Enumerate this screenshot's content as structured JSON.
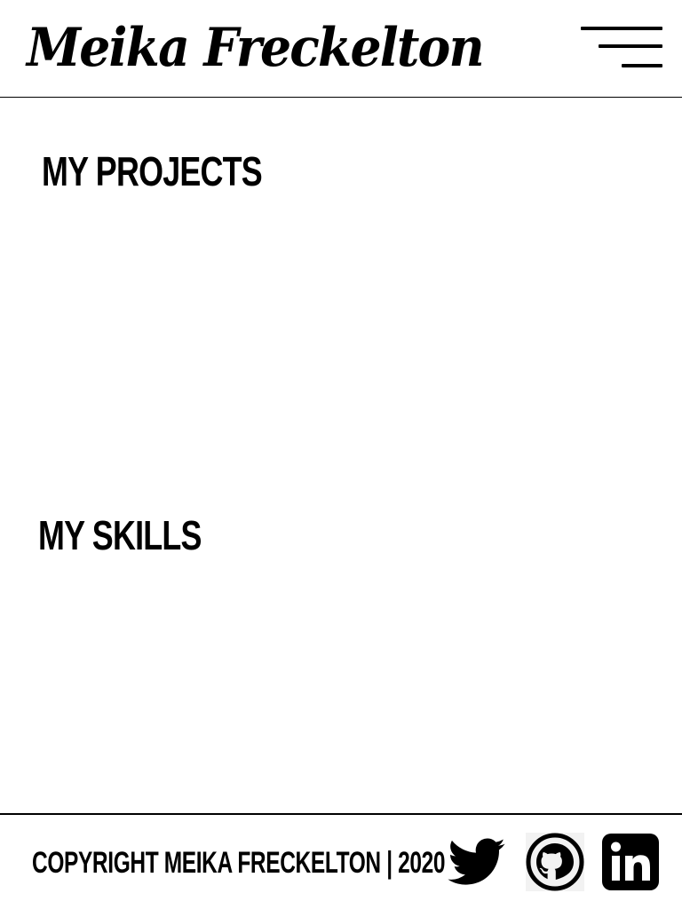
{
  "header": {
    "brand": "Meika Freckelton",
    "menu_icon": "hamburger-menu-icon"
  },
  "sections": {
    "projects": {
      "title": "MY PROJECTS"
    },
    "skills": {
      "title": "MY SKILLS"
    }
  },
  "footer": {
    "copyright": "COPYRIGHT MEIKA FRECKELTON | 2020",
    "social": [
      {
        "icon": "twitter-icon"
      },
      {
        "icon": "github-icon"
      },
      {
        "icon": "linkedin-icon"
      }
    ]
  },
  "colors": {
    "background": "#ffffff",
    "foreground": "#000000"
  }
}
